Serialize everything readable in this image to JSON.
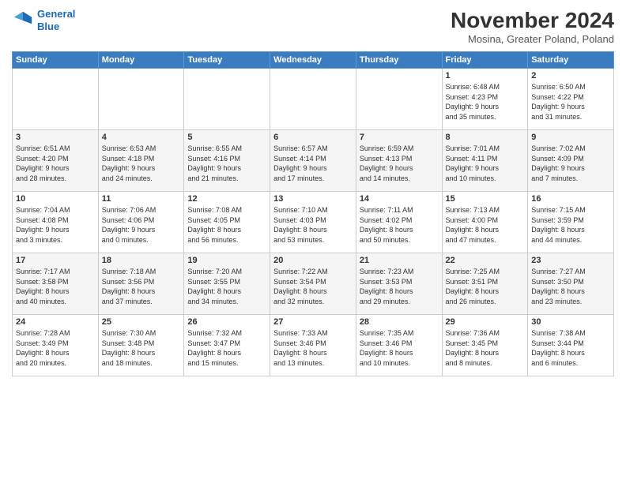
{
  "header": {
    "logo_line1": "General",
    "logo_line2": "Blue",
    "month_title": "November 2024",
    "location": "Mosina, Greater Poland, Poland"
  },
  "weekdays": [
    "Sunday",
    "Monday",
    "Tuesday",
    "Wednesday",
    "Thursday",
    "Friday",
    "Saturday"
  ],
  "weeks": [
    [
      {
        "day": "",
        "info": ""
      },
      {
        "day": "",
        "info": ""
      },
      {
        "day": "",
        "info": ""
      },
      {
        "day": "",
        "info": ""
      },
      {
        "day": "",
        "info": ""
      },
      {
        "day": "1",
        "info": "Sunrise: 6:48 AM\nSunset: 4:23 PM\nDaylight: 9 hours\nand 35 minutes."
      },
      {
        "day": "2",
        "info": "Sunrise: 6:50 AM\nSunset: 4:22 PM\nDaylight: 9 hours\nand 31 minutes."
      }
    ],
    [
      {
        "day": "3",
        "info": "Sunrise: 6:51 AM\nSunset: 4:20 PM\nDaylight: 9 hours\nand 28 minutes."
      },
      {
        "day": "4",
        "info": "Sunrise: 6:53 AM\nSunset: 4:18 PM\nDaylight: 9 hours\nand 24 minutes."
      },
      {
        "day": "5",
        "info": "Sunrise: 6:55 AM\nSunset: 4:16 PM\nDaylight: 9 hours\nand 21 minutes."
      },
      {
        "day": "6",
        "info": "Sunrise: 6:57 AM\nSunset: 4:14 PM\nDaylight: 9 hours\nand 17 minutes."
      },
      {
        "day": "7",
        "info": "Sunrise: 6:59 AM\nSunset: 4:13 PM\nDaylight: 9 hours\nand 14 minutes."
      },
      {
        "day": "8",
        "info": "Sunrise: 7:01 AM\nSunset: 4:11 PM\nDaylight: 9 hours\nand 10 minutes."
      },
      {
        "day": "9",
        "info": "Sunrise: 7:02 AM\nSunset: 4:09 PM\nDaylight: 9 hours\nand 7 minutes."
      }
    ],
    [
      {
        "day": "10",
        "info": "Sunrise: 7:04 AM\nSunset: 4:08 PM\nDaylight: 9 hours\nand 3 minutes."
      },
      {
        "day": "11",
        "info": "Sunrise: 7:06 AM\nSunset: 4:06 PM\nDaylight: 9 hours\nand 0 minutes."
      },
      {
        "day": "12",
        "info": "Sunrise: 7:08 AM\nSunset: 4:05 PM\nDaylight: 8 hours\nand 56 minutes."
      },
      {
        "day": "13",
        "info": "Sunrise: 7:10 AM\nSunset: 4:03 PM\nDaylight: 8 hours\nand 53 minutes."
      },
      {
        "day": "14",
        "info": "Sunrise: 7:11 AM\nSunset: 4:02 PM\nDaylight: 8 hours\nand 50 minutes."
      },
      {
        "day": "15",
        "info": "Sunrise: 7:13 AM\nSunset: 4:00 PM\nDaylight: 8 hours\nand 47 minutes."
      },
      {
        "day": "16",
        "info": "Sunrise: 7:15 AM\nSunset: 3:59 PM\nDaylight: 8 hours\nand 44 minutes."
      }
    ],
    [
      {
        "day": "17",
        "info": "Sunrise: 7:17 AM\nSunset: 3:58 PM\nDaylight: 8 hours\nand 40 minutes."
      },
      {
        "day": "18",
        "info": "Sunrise: 7:18 AM\nSunset: 3:56 PM\nDaylight: 8 hours\nand 37 minutes."
      },
      {
        "day": "19",
        "info": "Sunrise: 7:20 AM\nSunset: 3:55 PM\nDaylight: 8 hours\nand 34 minutes."
      },
      {
        "day": "20",
        "info": "Sunrise: 7:22 AM\nSunset: 3:54 PM\nDaylight: 8 hours\nand 32 minutes."
      },
      {
        "day": "21",
        "info": "Sunrise: 7:23 AM\nSunset: 3:53 PM\nDaylight: 8 hours\nand 29 minutes."
      },
      {
        "day": "22",
        "info": "Sunrise: 7:25 AM\nSunset: 3:51 PM\nDaylight: 8 hours\nand 26 minutes."
      },
      {
        "day": "23",
        "info": "Sunrise: 7:27 AM\nSunset: 3:50 PM\nDaylight: 8 hours\nand 23 minutes."
      }
    ],
    [
      {
        "day": "24",
        "info": "Sunrise: 7:28 AM\nSunset: 3:49 PM\nDaylight: 8 hours\nand 20 minutes."
      },
      {
        "day": "25",
        "info": "Sunrise: 7:30 AM\nSunset: 3:48 PM\nDaylight: 8 hours\nand 18 minutes."
      },
      {
        "day": "26",
        "info": "Sunrise: 7:32 AM\nSunset: 3:47 PM\nDaylight: 8 hours\nand 15 minutes."
      },
      {
        "day": "27",
        "info": "Sunrise: 7:33 AM\nSunset: 3:46 PM\nDaylight: 8 hours\nand 13 minutes."
      },
      {
        "day": "28",
        "info": "Sunrise: 7:35 AM\nSunset: 3:46 PM\nDaylight: 8 hours\nand 10 minutes."
      },
      {
        "day": "29",
        "info": "Sunrise: 7:36 AM\nSunset: 3:45 PM\nDaylight: 8 hours\nand 8 minutes."
      },
      {
        "day": "30",
        "info": "Sunrise: 7:38 AM\nSunset: 3:44 PM\nDaylight: 8 hours\nand 6 minutes."
      }
    ]
  ]
}
